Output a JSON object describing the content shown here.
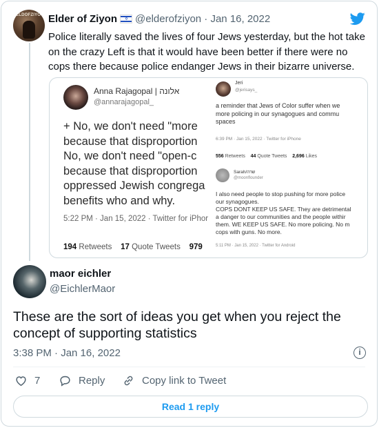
{
  "main_tweet": {
    "name": "Elder of Ziyon",
    "flag": "israel-flag",
    "handle": "@elderofziyon",
    "separator": "·",
    "date": "Jan 16, 2022",
    "text": "Police literally saved the lives of four Jews yesterday, but the hot take on the crazy Left is that it would have been better if there were no cops there because police endanger Jews in their bizarre universe.",
    "avatar_text": "ELDOFZIYO"
  },
  "quoted_image": {
    "left": {
      "name": "Anna Rajagopal | אלונה",
      "handle": "@annarajagopal_",
      "text": "+ No, we don't need \"more\nbecause that disproportion\nNo, we don't need \"open-c\nbecause that disproportion\noppressed Jewish congrega\nbenefits who and why.",
      "meta": "5:22 PM · Jan 15, 2022 · Twitter for iPhor",
      "retweets": "194",
      "retweets_label": "Retweets",
      "quotes": "17",
      "quotes_label": "Quote Tweets",
      "likes_partial": "979"
    },
    "right_top": {
      "name": "Jeri",
      "handle": "@jerisays_",
      "text": "a reminder that Jews of Color suffer when we\nmore policing in our synagogues and commu\nspaces",
      "meta": "6:39 PM · Jan 15, 2022 · Twitter for iPhone",
      "retweets": "556",
      "retweets_label": "Retweets",
      "quotes": "44",
      "quotes_label": "Quote Tweets",
      "likes": "2,696",
      "likes_label": "Likes"
    },
    "right_bottom": {
      "name": "Sarah/שרה",
      "handle": "@moonflounder",
      "text": "I also need people to stop pushing for more police\nour synagogues.\nCOPS DONT KEEP US SAFE. They are detrimental\na danger to our communities and the people withir\nthem. WE KEEP US SAFE. No more policing. No m\ncops with guns. No more.",
      "meta": "5:11 PM · Jan 15, 2022 · Twitter for Android"
    }
  },
  "reply": {
    "name": "maor eichler",
    "handle": "@EichlerMaor",
    "text": "These are the sort of ideas you get when you reject the concept of supporting statistics",
    "timestamp": "3:38 PM · Jan 16, 2022",
    "info_icon": "info-icon"
  },
  "actions": {
    "like_count": "7",
    "reply_label": "Reply",
    "copy_label": "Copy link to Tweet"
  },
  "read_replies": "Read 1 reply",
  "colors": {
    "accent": "#1d9bf0",
    "secondary_text": "#536471",
    "border": "#cfd9de"
  }
}
